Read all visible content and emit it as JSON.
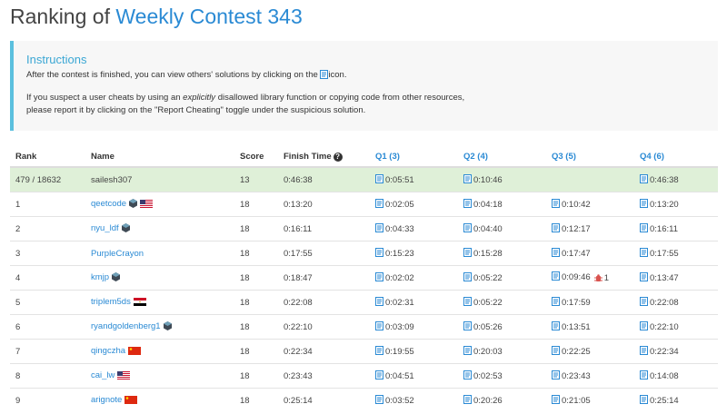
{
  "page": {
    "title_prefix": "Ranking of",
    "contest_name": "Weekly Contest 343"
  },
  "instructions": {
    "heading": "Instructions",
    "line1_before": "After the contest is finished, you can view others' solutions by clicking on the",
    "line1_after": "icon.",
    "line2_before": "If you suspect a user cheats by using an",
    "line2_em": "explicitly",
    "line2_after": "disallowed library function or copying code from other resources,",
    "line3": "please report it by clicking on the \"Report Cheating\" toggle under the suspicious solution."
  },
  "table": {
    "headers": {
      "rank": "Rank",
      "name": "Name",
      "score": "Score",
      "finish_time": "Finish Time",
      "q1": "Q1 (3)",
      "q2": "Q2 (4)",
      "q3": "Q3 (5)",
      "q4": "Q4 (6)"
    },
    "self_row": {
      "rank": "479 / 18632",
      "name": "sailesh307",
      "score": "13",
      "finish_time": "0:46:38",
      "q1": "0:05:51",
      "q2": "0:10:46",
      "q3": "",
      "q4": "0:46:38"
    },
    "rows": [
      {
        "rank": "1",
        "name": "qeetcode",
        "badge": "cube-icon",
        "flag": "us-flag-icon",
        "score": "18",
        "finish_time": "0:13:20",
        "q1": "0:02:05",
        "q2": "0:04:18",
        "q3": "0:10:42",
        "q4": "0:13:20",
        "bugs": ""
      },
      {
        "rank": "2",
        "name": "nyu_ldf",
        "badge": "cube-icon",
        "flag": "",
        "score": "18",
        "finish_time": "0:16:11",
        "q1": "0:04:33",
        "q2": "0:04:40",
        "q3": "0:12:17",
        "q4": "0:16:11",
        "bugs": ""
      },
      {
        "rank": "3",
        "name": "PurpleCrayon",
        "badge": "",
        "flag": "",
        "score": "18",
        "finish_time": "0:17:55",
        "q1": "0:15:23",
        "q2": "0:15:28",
        "q3": "0:17:47",
        "q4": "0:17:55",
        "bugs": ""
      },
      {
        "rank": "4",
        "name": "kmjp",
        "badge": "cube-icon",
        "flag": "",
        "score": "18",
        "finish_time": "0:18:47",
        "q1": "0:02:02",
        "q2": "0:05:22",
        "q3": "0:09:46",
        "q4": "0:13:47",
        "bugs": "1"
      },
      {
        "rank": "5",
        "name": "triplem5ds",
        "badge": "",
        "flag": "eg-flag-icon",
        "score": "18",
        "finish_time": "0:22:08",
        "q1": "0:02:31",
        "q2": "0:05:22",
        "q3": "0:17:59",
        "q4": "0:22:08",
        "bugs": ""
      },
      {
        "rank": "6",
        "name": "ryandgoldenberg1",
        "badge": "cube-icon",
        "flag": "",
        "score": "18",
        "finish_time": "0:22:10",
        "q1": "0:03:09",
        "q2": "0:05:26",
        "q3": "0:13:51",
        "q4": "0:22:10",
        "bugs": ""
      },
      {
        "rank": "7",
        "name": "qingczha",
        "badge": "",
        "flag": "cn-flag-icon",
        "score": "18",
        "finish_time": "0:22:34",
        "q1": "0:19:55",
        "q2": "0:20:03",
        "q3": "0:22:25",
        "q4": "0:22:34",
        "bugs": ""
      },
      {
        "rank": "8",
        "name": "cai_lw",
        "badge": "",
        "flag": "us-flag-icon",
        "score": "18",
        "finish_time": "0:23:43",
        "q1": "0:04:51",
        "q2": "0:02:53",
        "q3": "0:23:43",
        "q4": "0:14:08",
        "bugs": ""
      },
      {
        "rank": "9",
        "name": "arignote",
        "badge": "",
        "flag": "cn-flag-icon",
        "score": "18",
        "finish_time": "0:25:14",
        "q1": "0:03:52",
        "q2": "0:20:26",
        "q3": "0:21:05",
        "q4": "0:25:14",
        "bugs": ""
      }
    ]
  },
  "colors": {
    "link": "#2a8ad4",
    "self_row_bg": "#dff0d8",
    "instructions_accent": "#5bc0de"
  }
}
